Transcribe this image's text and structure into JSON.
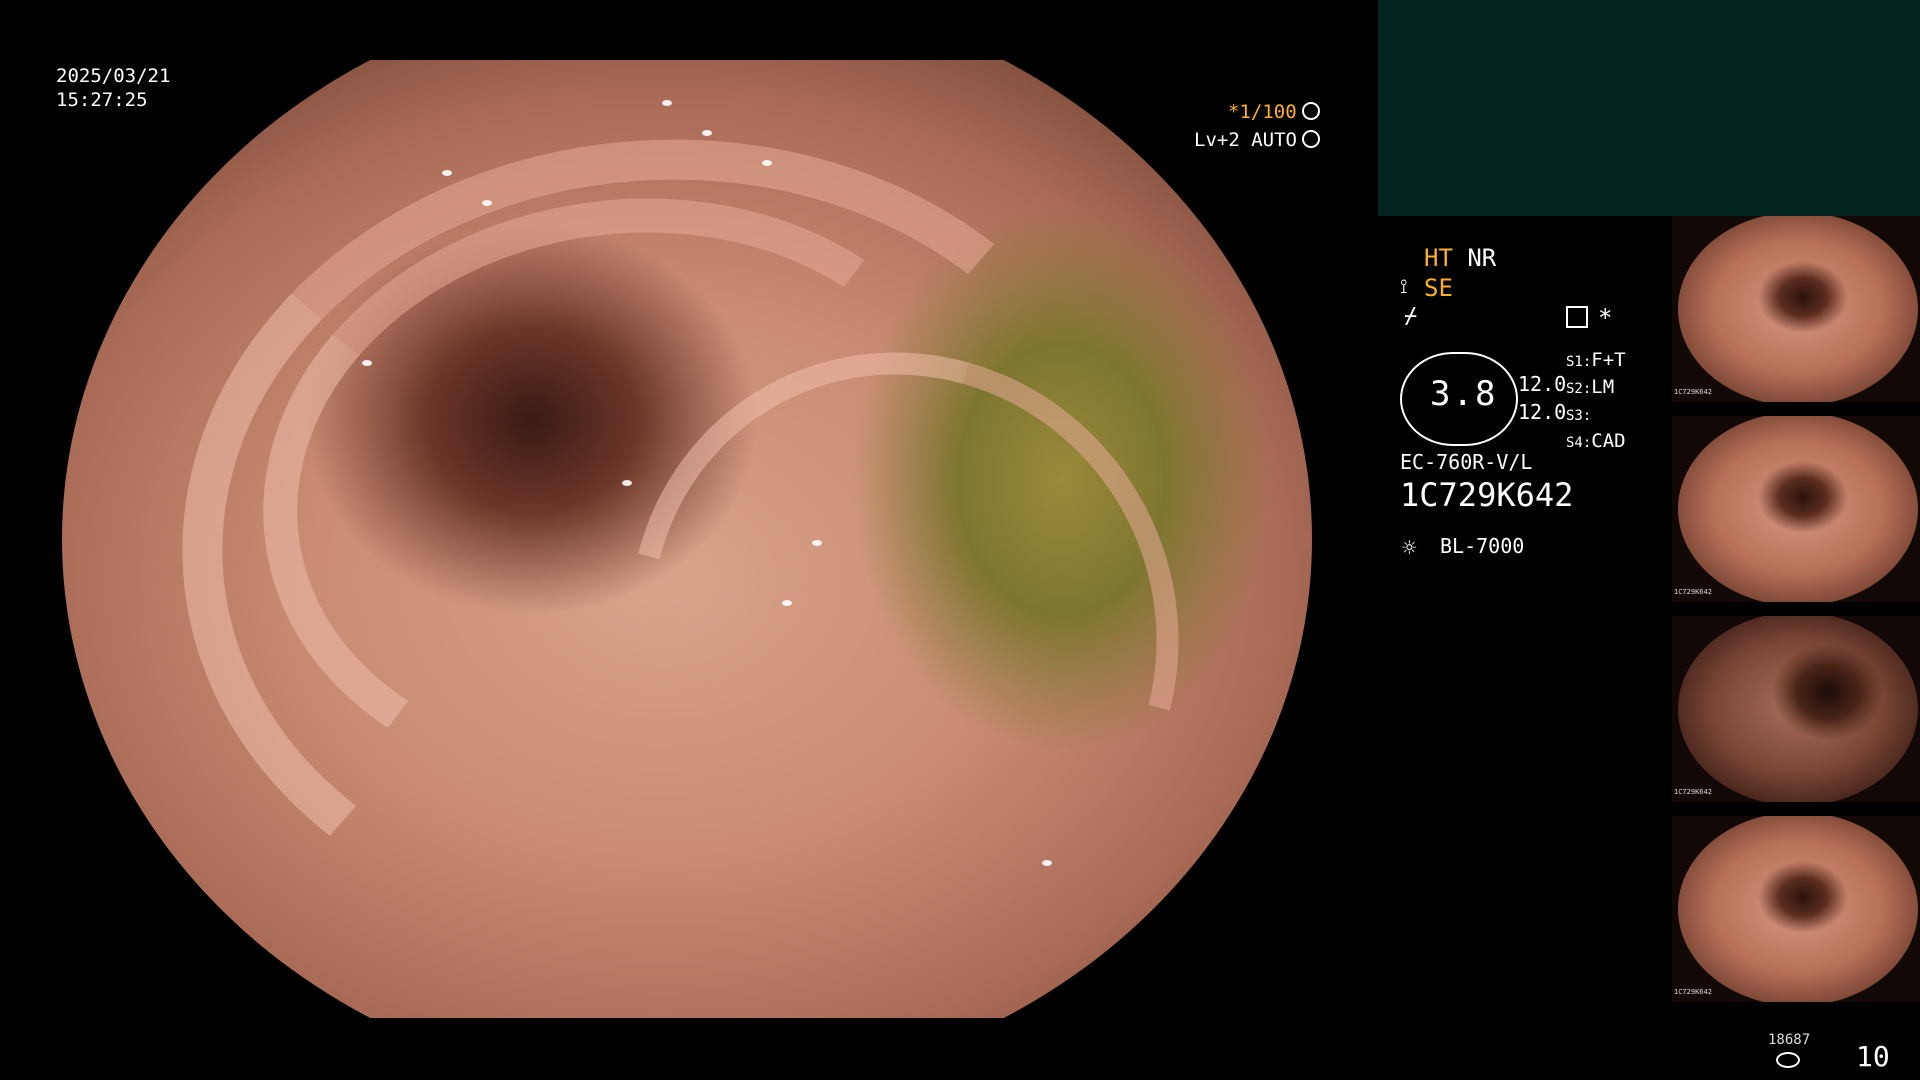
{
  "overlay": {
    "date": "2025/03/21",
    "time": "15:27:25",
    "shutter": "*1/100",
    "shutter_icon": "aperture-icon",
    "level": "Lv+2 AUTO",
    "level_icon": "gear-icon"
  },
  "settings": {
    "ht": "HT",
    "nr": "NR",
    "se": "SE",
    "mode_icon": "brightness-icon",
    "record_icon": "document-icon",
    "asterisk": "*"
  },
  "scope": {
    "diameter": "3.8",
    "val1": "12.0",
    "val2": "12.0",
    "s1_label": "S1:",
    "s1_value": "F+T",
    "s2_label": "S2:",
    "s2_value": "LM",
    "s3_label": "S3:",
    "s3_value": "",
    "s4_label": "S4:",
    "s4_value": "CAD",
    "model": "EC-760R-V/L",
    "serial": "1C729K642",
    "light_icon": "light-source-icon",
    "light_source": "BL-7000"
  },
  "thumbnails": [
    {
      "caption": "1C729K642"
    },
    {
      "caption": "1C729K642"
    },
    {
      "caption": "1C729K642"
    },
    {
      "caption": "1C729K642"
    }
  ],
  "footer": {
    "storage_count": "18687",
    "storage_icon": "database-icon",
    "image_count": "10"
  }
}
